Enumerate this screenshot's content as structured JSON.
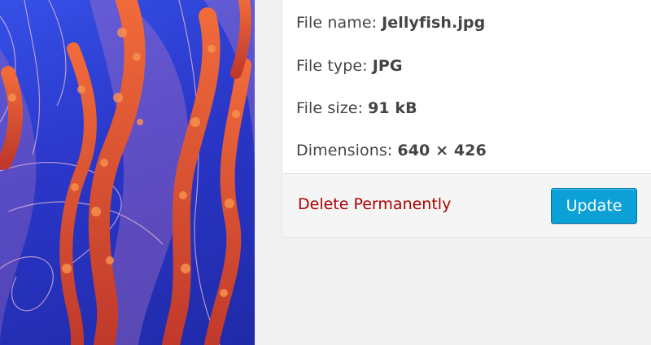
{
  "details": {
    "rows": [
      {
        "label": "File name:",
        "value": "Jellyfish.jpg"
      },
      {
        "label": "File type:",
        "value": "JPG"
      },
      {
        "label": "File size:",
        "value": "91 kB"
      },
      {
        "label": "Dimensions:",
        "value": "640 × 426"
      }
    ]
  },
  "actions": {
    "delete_label": "Delete Permanently",
    "update_label": "Update"
  },
  "colors": {
    "delete_link": "#aa0000",
    "update_button": "#0ba1d6",
    "panel_background": "#ffffff",
    "page_background": "#f1f1f1"
  }
}
